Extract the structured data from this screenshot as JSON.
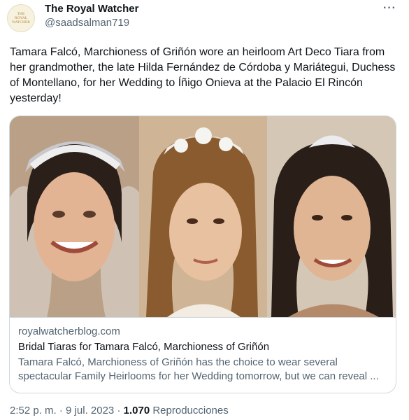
{
  "author": {
    "name": "The Royal Watcher",
    "handle": "@saadsalman719",
    "avatar_lines": [
      "THE",
      "ROYAL",
      "WATCHER"
    ]
  },
  "more_icon": "more-horizontal-icon",
  "tweet": {
    "text": "Tamara Falcó, Marchioness of Griñón wore an heirloom Art Deco Tiara from her grandmother, the late Hilda Fernández de Córdoba y Mariátegui, Duchess of Montellano, for her Wedding to Íñigo Onieva at the Palacio El Rincón yesterday!"
  },
  "link_card": {
    "domain": "royalwatcherblog.com",
    "title": "Bridal Tiaras for Tamara Falcó, Marchioness of Griñón",
    "description": "Tamara Falcó, Marchioness of Griñón has the choice to wear several spectacular Family Heirlooms for her Wedding tomorrow, but we can reveal ..."
  },
  "meta": {
    "time": "2:52 p. m.",
    "separator": "·",
    "date": "9 jul. 2023",
    "views": "1.070",
    "views_label": "Reproducciones"
  },
  "colors": {
    "text": "#0f1419",
    "muted": "#536471",
    "border": "#cfd9de"
  }
}
